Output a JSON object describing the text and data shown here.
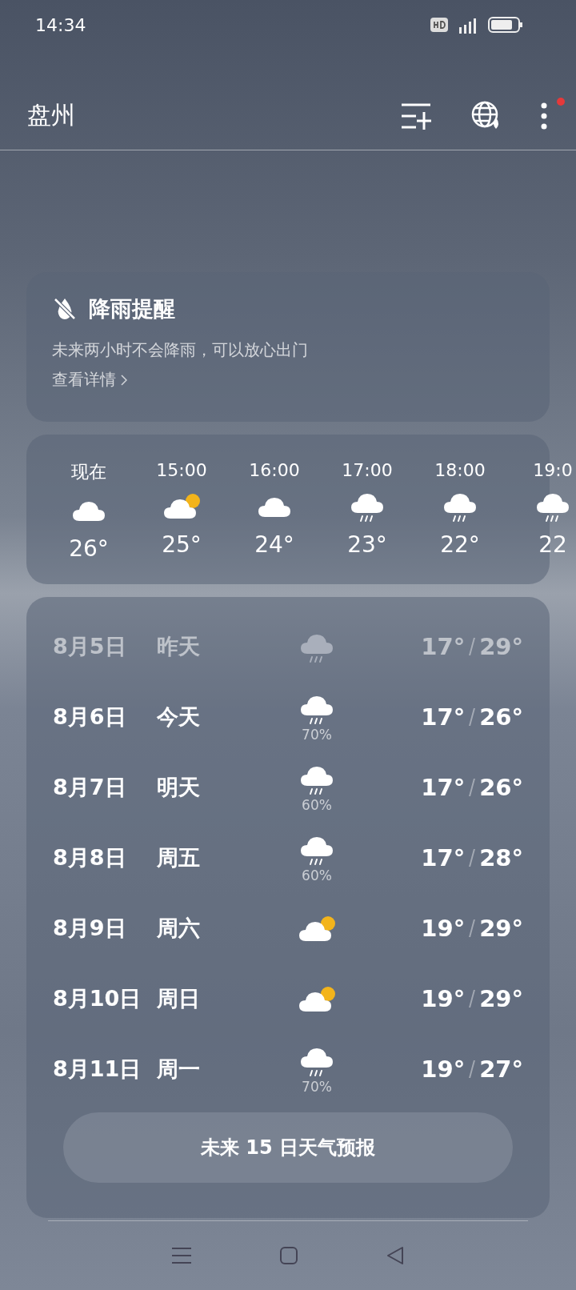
{
  "status_bar": {
    "time": "14:34"
  },
  "header": {
    "city": "盘州",
    "menu_badge": true
  },
  "rain_alert": {
    "title": "降雨提醒",
    "message": "未来两小时不会降雨，可以放心出门",
    "link": "查看详情"
  },
  "hourly": [
    {
      "time": "现在",
      "kind": "cloudy",
      "temp": "26°"
    },
    {
      "time": "15:00",
      "kind": "partly",
      "temp": "25°"
    },
    {
      "time": "16:00",
      "kind": "cloudy",
      "temp": "24°"
    },
    {
      "time": "17:00",
      "kind": "rain",
      "temp": "23°"
    },
    {
      "time": "18:00",
      "kind": "rain",
      "temp": "22°"
    },
    {
      "time": "19:0",
      "kind": "rain",
      "temp": "22"
    }
  ],
  "daily": [
    {
      "date": "8月5日",
      "day": "昨天",
      "kind": "rain",
      "low": "17°",
      "high": "29°",
      "past": true
    },
    {
      "date": "8月6日",
      "day": "今天",
      "kind": "rain",
      "chance": "70%",
      "low": "17°",
      "high": "26°",
      "past": false
    },
    {
      "date": "8月7日",
      "day": "明天",
      "kind": "rain",
      "chance": "60%",
      "low": "17°",
      "high": "26°",
      "past": false
    },
    {
      "date": "8月8日",
      "day": "周五",
      "kind": "rain",
      "chance": "60%",
      "low": "17°",
      "high": "28°",
      "past": false
    },
    {
      "date": "8月9日",
      "day": "周六",
      "kind": "partly",
      "low": "19°",
      "high": "29°",
      "past": false
    },
    {
      "date": "8月10日",
      "day": "周日",
      "kind": "partly",
      "low": "19°",
      "high": "29°",
      "past": false
    },
    {
      "date": "8月11日",
      "day": "周一",
      "kind": "rain",
      "chance": "70%",
      "low": "19°",
      "high": "27°",
      "past": false
    }
  ],
  "forecast_button": "未来 15 日天气预报"
}
